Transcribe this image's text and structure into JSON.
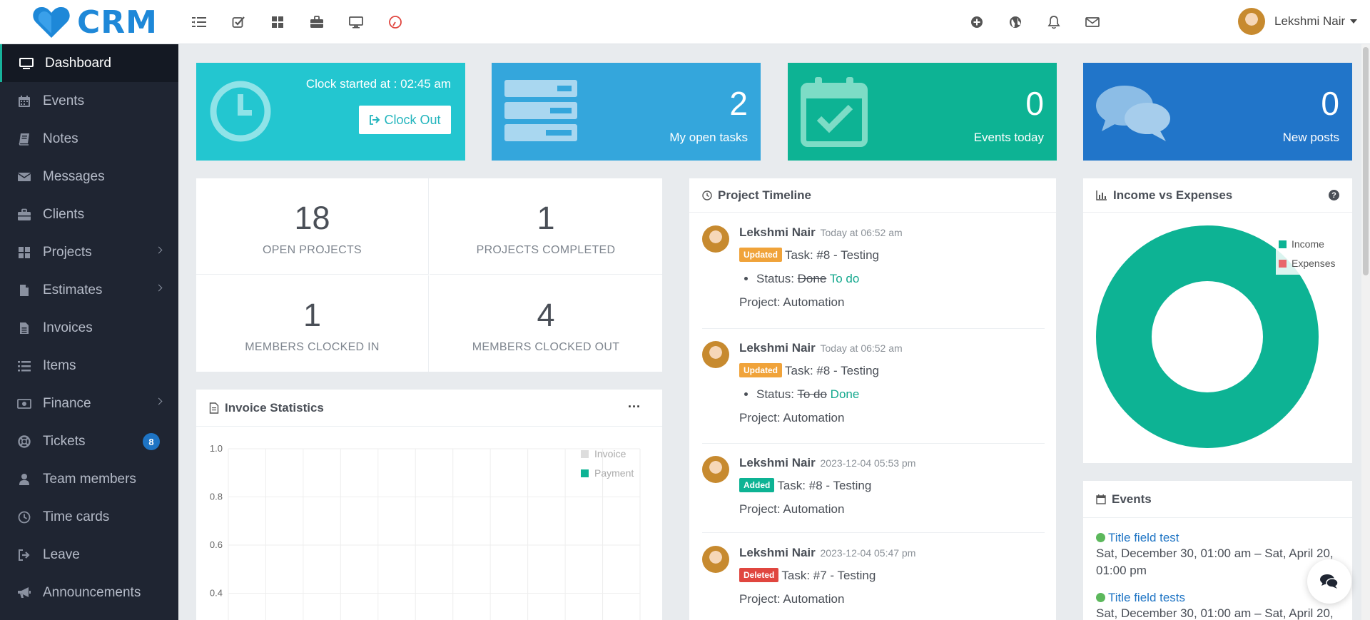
{
  "brand": {
    "name": "CRM",
    "logo_color": "#1e88d8"
  },
  "topbar": {
    "left_icons": [
      "sidebar-toggle-icon",
      "checklist-icon",
      "grid-icon",
      "briefcase-icon",
      "monitor-icon",
      "clock-timer-icon"
    ],
    "right_icons": [
      "plus-circle-icon",
      "globe-icon",
      "bell-icon",
      "envelope-icon"
    ],
    "user_name": "Lekshmi Nair"
  },
  "sidebar": {
    "items": [
      {
        "label": "Dashboard",
        "icon": "monitor-icon"
      },
      {
        "label": "Events",
        "icon": "calendar-icon"
      },
      {
        "label": "Notes",
        "icon": "book-icon"
      },
      {
        "label": "Messages",
        "icon": "envelope-icon"
      },
      {
        "label": "Clients",
        "icon": "briefcase-icon"
      },
      {
        "label": "Projects",
        "icon": "grid-icon"
      },
      {
        "label": "Estimates",
        "icon": "file-icon"
      },
      {
        "label": "Invoices",
        "icon": "file-text-icon"
      },
      {
        "label": "Items",
        "icon": "list-icon"
      },
      {
        "label": "Finance",
        "icon": "money-icon"
      },
      {
        "label": "Tickets",
        "icon": "lifebuoy-icon",
        "badge": "8"
      },
      {
        "label": "Team members",
        "icon": "user-icon"
      },
      {
        "label": "Time cards",
        "icon": "clock-icon"
      },
      {
        "label": "Leave",
        "icon": "sign-out-icon"
      },
      {
        "label": "Announcements",
        "icon": "bullhorn-icon"
      }
    ]
  },
  "widgets": {
    "clock": {
      "text": "Clock started at : 02:45 am",
      "button": "Clock Out"
    },
    "tasks": {
      "value": "2",
      "label": "My open tasks"
    },
    "events": {
      "value": "0",
      "label": "Events today"
    },
    "posts": {
      "value": "0",
      "label": "New posts"
    }
  },
  "project_stats": [
    {
      "value": "18",
      "label": "OPEN PROJECTS"
    },
    {
      "value": "1",
      "label": "PROJECTS COMPLETED"
    },
    {
      "value": "1",
      "label": "MEMBERS CLOCKED IN"
    },
    {
      "value": "4",
      "label": "MEMBERS CLOCKED OUT"
    }
  ],
  "invoice_statistics": {
    "title": "Invoice Statistics",
    "menu": "···",
    "legend": [
      {
        "name": "Invoice",
        "color": "#dddddd"
      },
      {
        "name": "Payment",
        "color": "#0db394"
      }
    ]
  },
  "chart_data": {
    "type": "line",
    "title": "",
    "series": [
      {
        "name": "Invoice",
        "values": []
      },
      {
        "name": "Payment",
        "values": []
      }
    ],
    "yticks": [
      "1.0",
      "0.8",
      "0.6",
      "0.4"
    ],
    "ylim": [
      0,
      1
    ],
    "grid": true,
    "legend": "top-right"
  },
  "timeline": {
    "title": "Project Timeline",
    "items": [
      {
        "name": "Lekshmi Nair",
        "time": "Today at 06:52 am",
        "badge": "Updated",
        "task": "Task: #8 - Testing",
        "status_label": "Status:",
        "old": "Done",
        "new": "To do",
        "project": "Project: Automation"
      },
      {
        "name": "Lekshmi Nair",
        "time": "Today at 06:52 am",
        "badge": "Updated",
        "task": "Task: #8 - Testing",
        "status_label": "Status:",
        "old": "To do",
        "new": "Done",
        "project": "Project: Automation"
      },
      {
        "name": "Lekshmi Nair",
        "time": "2023-12-04 05:53 pm",
        "badge": "Added",
        "task": "Task: #8 - Testing",
        "project": "Project: Automation"
      },
      {
        "name": "Lekshmi Nair",
        "time": "2023-12-04 05:47 pm",
        "badge": "Deleted",
        "task": "Task: #7 - Testing",
        "project": "Project: Automation"
      }
    ]
  },
  "income_expenses": {
    "title": "Income vs Expenses",
    "legend": [
      {
        "name": "Income",
        "color": "#0db394"
      },
      {
        "name": "Expenses",
        "color": "#e8666a"
      }
    ]
  },
  "events_panel": {
    "title": "Events",
    "items": [
      {
        "title": "Title field test",
        "date": "Sat, December 30, 01:00 am – Sat, April 20, 01:00 pm"
      },
      {
        "title": "Title field tests",
        "date": "Sat, December 30, 01:00 am – Sat, April 20,"
      }
    ]
  }
}
